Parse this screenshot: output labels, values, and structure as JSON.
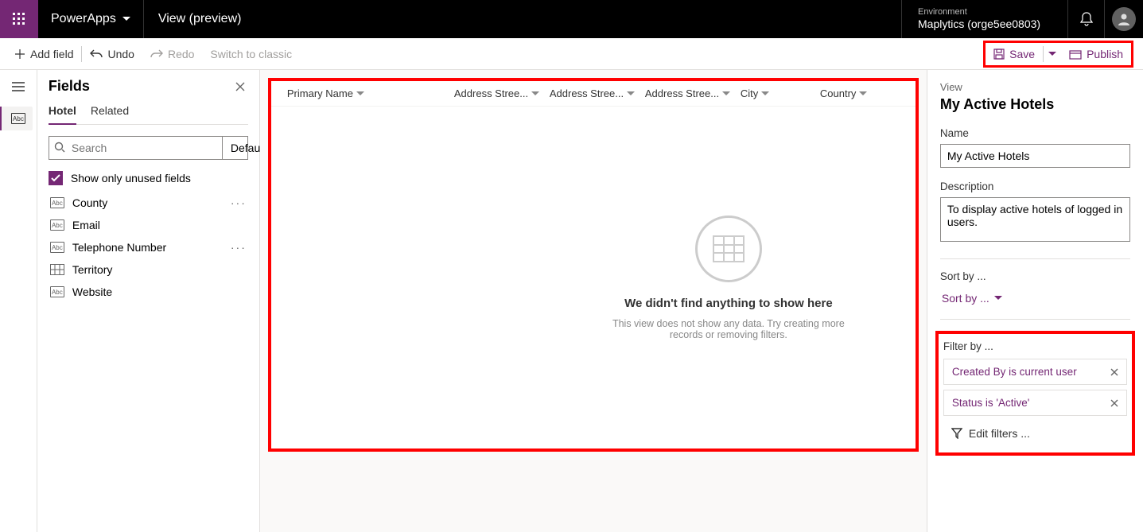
{
  "header": {
    "app_name": "PowerApps",
    "page_title": "View (preview)",
    "env_label": "Environment",
    "env_name": "Maplytics (orge5ee0803)"
  },
  "cmdbar": {
    "add_field": "Add field",
    "undo": "Undo",
    "redo": "Redo",
    "switch_classic": "Switch to classic",
    "save": "Save",
    "publish": "Publish"
  },
  "fields_panel": {
    "title": "Fields",
    "tabs": {
      "hotel": "Hotel",
      "related": "Related"
    },
    "search_placeholder": "Search",
    "sort_label": "Default",
    "show_unused": "Show only unused fields",
    "items": [
      {
        "label": "County",
        "type": "text",
        "more": true
      },
      {
        "label": "Email",
        "type": "text",
        "more": false
      },
      {
        "label": "Telephone Number",
        "type": "text",
        "more": true
      },
      {
        "label": "Territory",
        "type": "lookup",
        "more": false
      },
      {
        "label": "Website",
        "type": "text",
        "more": false
      }
    ]
  },
  "grid": {
    "columns": [
      "Primary Name",
      "Address Stree...",
      "Address Stree...",
      "Address Stree...",
      "City",
      "Country"
    ],
    "empty_title": "We didn't find anything to show here",
    "empty_sub": "This view does not show any data. Try creating more records or removing filters."
  },
  "props": {
    "view_label": "View",
    "view_title": "My Active Hotels",
    "name_label": "Name",
    "name_value": "My Active Hotels",
    "desc_label": "Description",
    "desc_value": "To display active hotels of logged in users.",
    "sortby_label": "Sort by ...",
    "sortby_link": "Sort by ...",
    "filterby_label": "Filter by ...",
    "filters": [
      "Created By is current user",
      "Status is 'Active'"
    ],
    "edit_filters": "Edit filters ..."
  }
}
